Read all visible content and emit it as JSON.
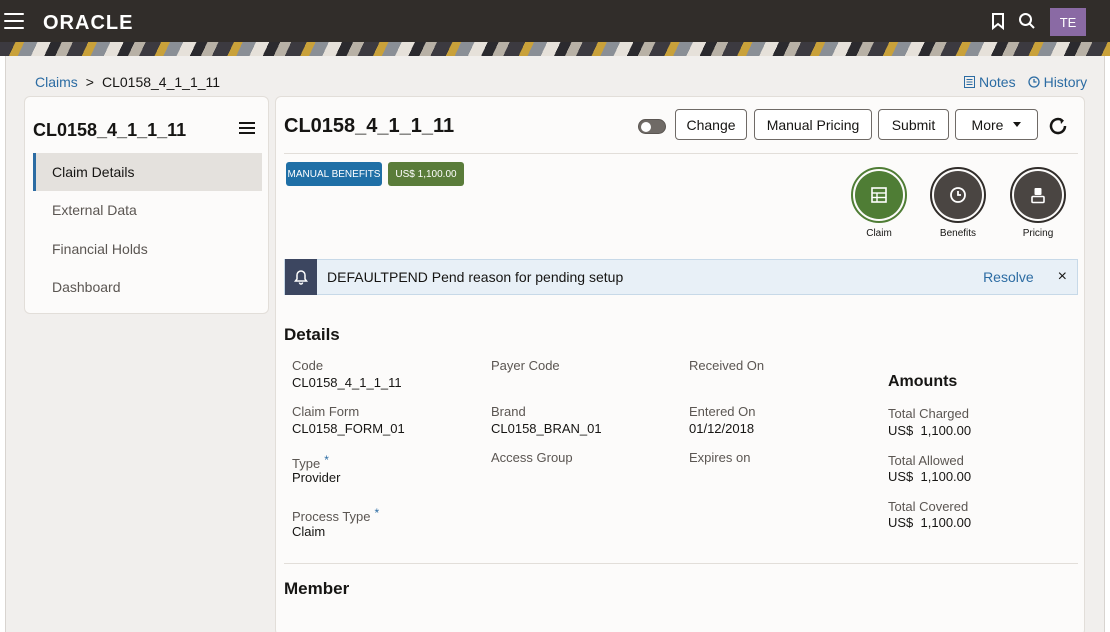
{
  "header": {
    "logo": "ORACLE",
    "avatar_initials": "TE",
    "icons": [
      "hamburger-icon",
      "bookmark-icon",
      "search-icon"
    ]
  },
  "breadcrumb": {
    "parent": "Claims",
    "separator": ">",
    "current": "CL0158_4_1_1_11"
  },
  "toplinks": {
    "notes": "Notes",
    "history": "History"
  },
  "sidebar": {
    "title": "CL0158_4_1_1_11",
    "items": [
      {
        "label": "Claim Details"
      },
      {
        "label": "External Data"
      },
      {
        "label": "Financial Holds"
      },
      {
        "label": "Dashboard"
      }
    ]
  },
  "main": {
    "title": "CL0158_4_1_1_11",
    "buttons": {
      "change": "Change",
      "manual_pricing": "Manual Pricing",
      "submit": "Submit",
      "more": "More"
    },
    "badges": {
      "manual_benefits": "MANUAL BENEFITS",
      "amount": "US$ 1,100.00"
    },
    "shortcuts": {
      "claim": "Claim",
      "benefits": "Benefits",
      "pricing": "Pricing"
    },
    "alert": {
      "text": "DEFAULTPEND Pend reason for pending setup",
      "resolve": "Resolve",
      "close": "×"
    }
  },
  "details": {
    "title": "Details",
    "code_label": "Code",
    "code_value": "CL0158_4_1_1_11",
    "payer_code_label": "Payer Code",
    "received_on_label": "Received On",
    "claim_form_label": "Claim Form",
    "claim_form_value": "CL0158_FORM_01",
    "brand_label": "Brand",
    "brand_value": "CL0158_BRAN_01",
    "entered_on_label": "Entered On",
    "entered_on_value": "01/12/2018",
    "type_label": "Type",
    "type_value": "Provider",
    "access_group_label": "Access Group",
    "expires_on_label": "Expires on",
    "process_type_label": "Process Type",
    "process_type_value": "Claim",
    "required_mark": "*"
  },
  "amounts": {
    "title": "Amounts",
    "total_charged_label": "Total Charged",
    "total_charged_value": "US$  1,100.00",
    "total_allowed_label": "Total Allowed",
    "total_allowed_value": "US$  1,100.00",
    "total_covered_label": "Total Covered",
    "total_covered_value": "US$  1,100.00"
  },
  "member": {
    "title": "Member"
  },
  "colors": {
    "header": "#312d2a",
    "link": "#2c6ca3",
    "badge_blue": "#1f6fa6",
    "badge_green": "#5a7c3a",
    "claim_green": "#4f7d35",
    "circle_dark": "#4a4542"
  }
}
